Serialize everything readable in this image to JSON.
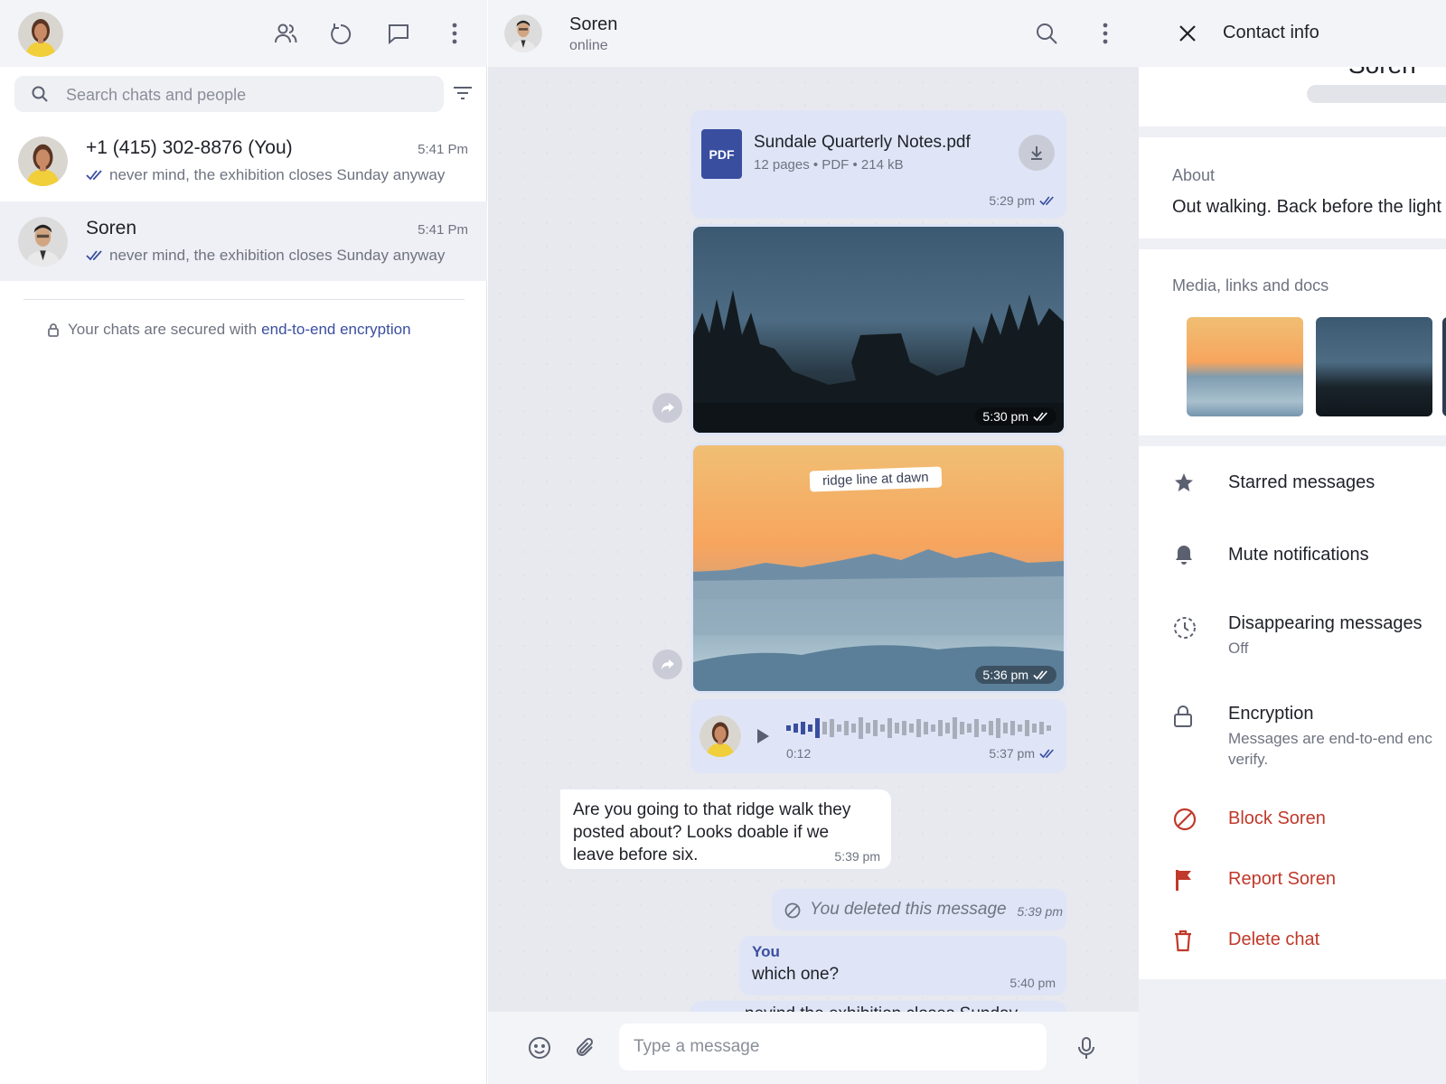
{
  "colors": {
    "accent": "#3a4ea0",
    "danger": "#c0392b",
    "outgoing_bubble": "#dfe5f6",
    "pdf_badge": "#3a4ea0"
  },
  "left": {
    "search_placeholder": "Search chats and people",
    "icons": [
      "contacts-icon",
      "status-icon",
      "new-chat-icon",
      "menu-icon",
      "filter-icon"
    ],
    "chats": [
      {
        "name": "+1 (415) 302-8876 (You)",
        "time": "5:41 Pm",
        "preview": "never mind, the exhibition closes Sunday anyway"
      },
      {
        "name": "Soren",
        "time": "5:41 Pm",
        "preview": "never mind, the exhibition closes Sunday anyway"
      }
    ],
    "encryption_text": "Your chats are secured with",
    "encryption_link": "end-to-end encryption"
  },
  "center": {
    "contact_name": "Soren",
    "contact_status": "online",
    "messages": {
      "pdf": {
        "badge": "PDF",
        "filename": "Sundale Quarterly Notes.pdf",
        "details": "12 pages • PDF • 214 kB",
        "time": "5:29 pm"
      },
      "image1": {
        "time": "5:30 pm"
      },
      "image2": {
        "caption": "ridge line at dawn",
        "time": "5:36 pm"
      },
      "voice": {
        "duration": "0:12",
        "time": "5:37 pm"
      },
      "incoming": {
        "text": "Are you going to that ridge walk they posted about? Looks doable if we leave before six.",
        "time": "5:39 pm"
      },
      "deleted": {
        "text": "You deleted this message",
        "time": "5:39 pm"
      },
      "reply": {
        "sender": "You",
        "text": "which one?",
        "time": "5:40 pm"
      },
      "partial": {
        "text": "nevind the exhibition closes Sunday"
      }
    },
    "composer_placeholder": "Type a message"
  },
  "right": {
    "title": "Contact info",
    "name_partial": "Soren",
    "about_label": "About",
    "about_text": "Out walking. Back before the light",
    "media_label": "Media, links and docs",
    "items": [
      {
        "label": "Starred messages",
        "icon": "star-icon"
      },
      {
        "label": "Mute notifications",
        "icon": "bell-icon"
      },
      {
        "label": "Disappearing messages",
        "sub": "Off",
        "icon": "timer-icon"
      },
      {
        "label": "Encryption",
        "sub": "Messages are end-to-end enc",
        "sub2": "verify.",
        "icon": "lock-icon"
      },
      {
        "label": "Block Soren",
        "icon": "block-icon"
      },
      {
        "label": "Report Soren",
        "icon": "flag-icon"
      },
      {
        "label": "Delete chat",
        "icon": "trash-icon"
      }
    ]
  }
}
